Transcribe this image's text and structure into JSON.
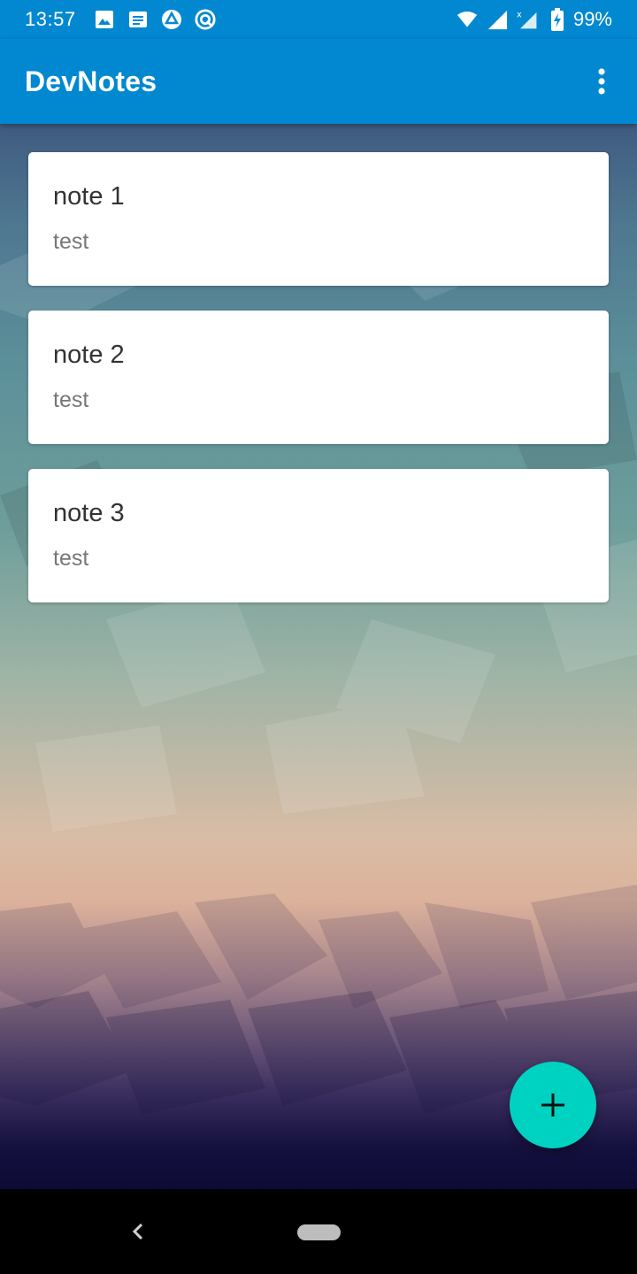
{
  "status_bar": {
    "time": "13:57",
    "battery": "99%",
    "left_icons": [
      "image-icon",
      "message-icon",
      "drive-icon",
      "sync-icon"
    ],
    "right_icons": [
      "wifi-icon",
      "signal-icon",
      "signal-no-data-icon",
      "battery-charging-icon"
    ]
  },
  "app_bar": {
    "title": "DevNotes",
    "overflow_icon": "more-vert-icon",
    "background": "#0288d1"
  },
  "notes": [
    {
      "title": "note 1",
      "body": "test"
    },
    {
      "title": "note 2",
      "body": "test"
    },
    {
      "title": "note 3",
      "body": "test"
    }
  ],
  "fab": {
    "icon": "plus-icon",
    "color": "#00d2c1"
  },
  "nav_bar": {
    "back_icon": "back-chevron-icon",
    "home_icon": "home-pill-icon"
  }
}
